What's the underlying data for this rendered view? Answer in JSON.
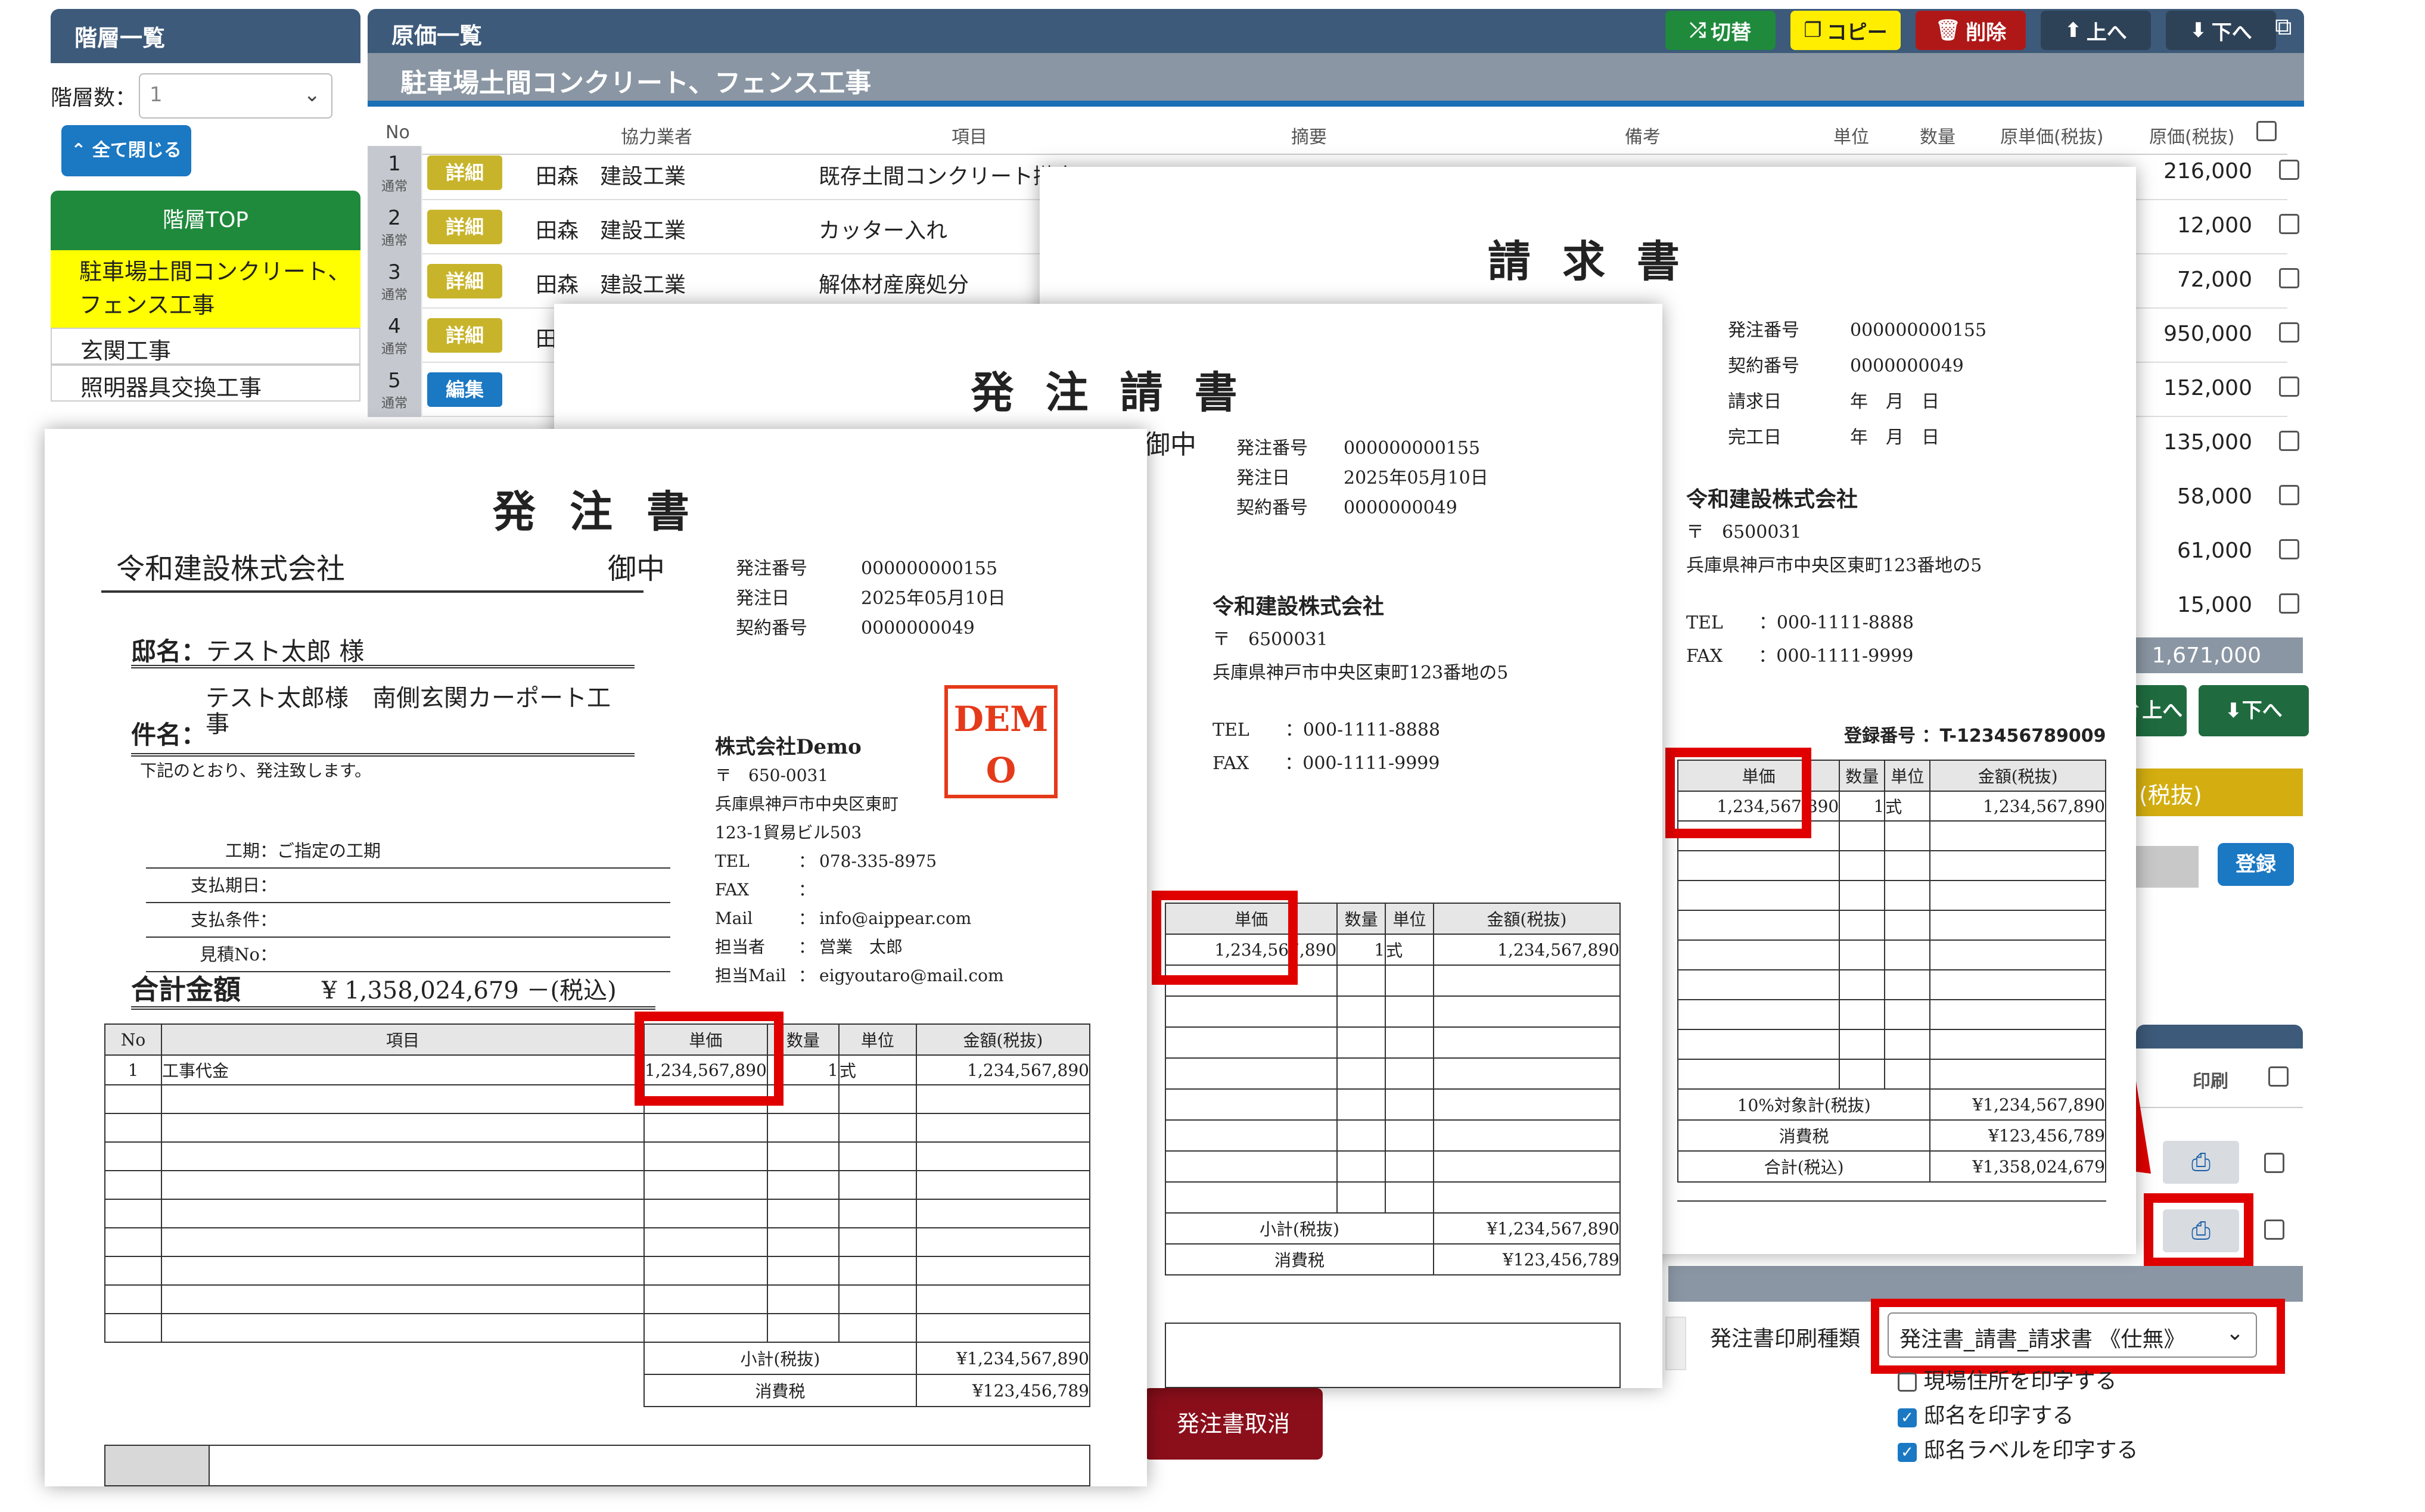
{
  "left_panel": {
    "title": "階層一覧",
    "count_label": "階層数：",
    "count_value": "1",
    "collapse_button": "全て閉じる",
    "top_label": "階層TOP",
    "items": [
      "駐車場土間コンクリート、\nフェンス工事",
      "玄関工事",
      "照明器具交換工事"
    ]
  },
  "main": {
    "title": "原価一覧",
    "project": "駐車場土間コンクリート、フェンス工事",
    "toolbar": {
      "switch": "切替",
      "copy": "コピー",
      "delete": "削除",
      "up": "上へ",
      "down": "下へ"
    },
    "columns": [
      "No",
      "協力業者",
      "項目",
      "摘要",
      "備考",
      "単位",
      "数量",
      "原単価(税抜)",
      "原価(税抜)"
    ],
    "rows": [
      {
        "no": "1",
        "type": "通常",
        "action": "詳細",
        "vendor": "田森　建設工業",
        "item": "既存土間コンクリート撤去"
      },
      {
        "no": "2",
        "type": "通常",
        "action": "詳細",
        "vendor": "田森　建設工業",
        "item": "カッター入れ"
      },
      {
        "no": "3",
        "type": "通常",
        "action": "詳細",
        "vendor": "田森　建設工業",
        "item": "解体材産廃処分"
      },
      {
        "no": "4",
        "type": "通常",
        "action": "詳細",
        "vendor": "田",
        "item": ""
      },
      {
        "no": "5",
        "type": "通常",
        "action": "編集",
        "vendor": "",
        "item": ""
      }
    ],
    "amounts": [
      "216,000",
      "12,000",
      "72,000",
      "950,000",
      "152,000",
      "135,000",
      "58,000",
      "61,000",
      "15,000"
    ],
    "total": "1,671,000",
    "bottom_up": "上へ",
    "bottom_down": "下へ",
    "tax_header": "(税抜)",
    "register": "登録",
    "print_header": "印刷",
    "print_type_label": "発注書印刷種類",
    "print_type_value": "発注書_請書_請求書 《仕無》",
    "options": [
      {
        "label": "現場住所を印字する",
        "checked": false
      },
      {
        "label": "邸名を印字する",
        "checked": true
      },
      {
        "label": "邸名ラベルを印字する",
        "checked": true
      }
    ],
    "cancel_button": "発注書取消"
  },
  "invoice": {
    "title": "請 求 書",
    "fields": [
      [
        "発注番号",
        "000000000155"
      ],
      [
        "契約番号",
        "0000000049"
      ],
      [
        "請求日",
        "年　月　日"
      ],
      [
        "完工日",
        "年　月　日"
      ]
    ],
    "company": "令和建設株式会社",
    "postal": "〒　6500031",
    "address": "兵庫県神戸市中央区東町123番地の5",
    "tel": "TEL　　：000-1111-8888",
    "fax": "FAX　　：000-1111-9999",
    "reg_no": "登録番号 ：T-123456789009",
    "headers": [
      "単価",
      "数量",
      "単位",
      "金額(税抜)"
    ],
    "row": [
      "1,234,567,890",
      "1",
      "式",
      "1,234,567,890"
    ],
    "summary": [
      [
        "10%対象計(税抜)",
        "¥1,234,567,890"
      ],
      [
        "消費税",
        "¥123,456,789"
      ],
      [
        "合計(税込)",
        "¥1,358,024,679"
      ]
    ]
  },
  "acceptance": {
    "title": "発 注 請 書",
    "suffix": "御中",
    "fields": [
      [
        "発注番号",
        "000000000155"
      ],
      [
        "発注日",
        "2025年05月10日"
      ],
      [
        "契約番号",
        "0000000049"
      ]
    ],
    "company": "令和建設株式会社",
    "postal": "〒　6500031",
    "address": "兵庫県神戸市中央区東町123番地の5",
    "tel": "TEL　　：000-1111-8888",
    "fax": "FAX　　：000-1111-9999",
    "headers": [
      "単価",
      "数量",
      "単位",
      "金額(税抜)"
    ],
    "row": [
      "1,234,567,890",
      "1",
      "式",
      "1,234,567,890"
    ],
    "summary": [
      [
        "小計(税抜)",
        "¥1,234,567,890"
      ],
      [
        "消費税",
        "¥123,456,789"
      ]
    ]
  },
  "order": {
    "title": "発 注 書",
    "to": "令和建設株式会社",
    "onchu": "御中",
    "fields": [
      [
        "発注番号",
        "000000000155"
      ],
      [
        "発注日",
        "2025年05月10日"
      ],
      [
        "契約番号",
        "0000000049"
      ]
    ],
    "house_label": "邸名：",
    "house_value": "テスト太郎 様",
    "subject_label": "件名：",
    "subject_value": "テスト太郎様　南側玄関カーポート工事",
    "note": "下記のとおり、発注致します。",
    "terms": [
      [
        "工期：",
        "ご指定の工期"
      ],
      [
        "支払期日：",
        ""
      ],
      [
        "支払条件：",
        ""
      ],
      [
        "見積No：",
        ""
      ]
    ],
    "total_label": "合計金額",
    "total_value": "¥ 1,358,024,679 －(税込)",
    "issuer": {
      "name": "株式会社Demo",
      "postal": "〒　650-0031",
      "addr1": "兵庫県神戸市中央区東町",
      "addr2": "123-1貿易ビル503",
      "lines": [
        [
          "TEL",
          "：",
          "078-335-8975"
        ],
        [
          "FAX",
          "：",
          ""
        ],
        [
          "Mail",
          "：",
          "info@aippear.com"
        ],
        [
          "担当者",
          "：",
          "営業　太郎"
        ],
        [
          "担当Mail",
          "：",
          "eigyoutaro@mail.com"
        ]
      ]
    },
    "stamp": "DEMO",
    "headers": [
      "No",
      "項目",
      "単価",
      "数量",
      "単位",
      "金額(税抜)"
    ],
    "row": [
      "1",
      "工事代金",
      "1,234,567,890",
      "1",
      "式",
      "1,234,567,890"
    ],
    "summary": [
      [
        "小計(税抜)",
        "¥1,234,567,890"
      ],
      [
        "消費税",
        "¥123,456,789"
      ]
    ]
  }
}
